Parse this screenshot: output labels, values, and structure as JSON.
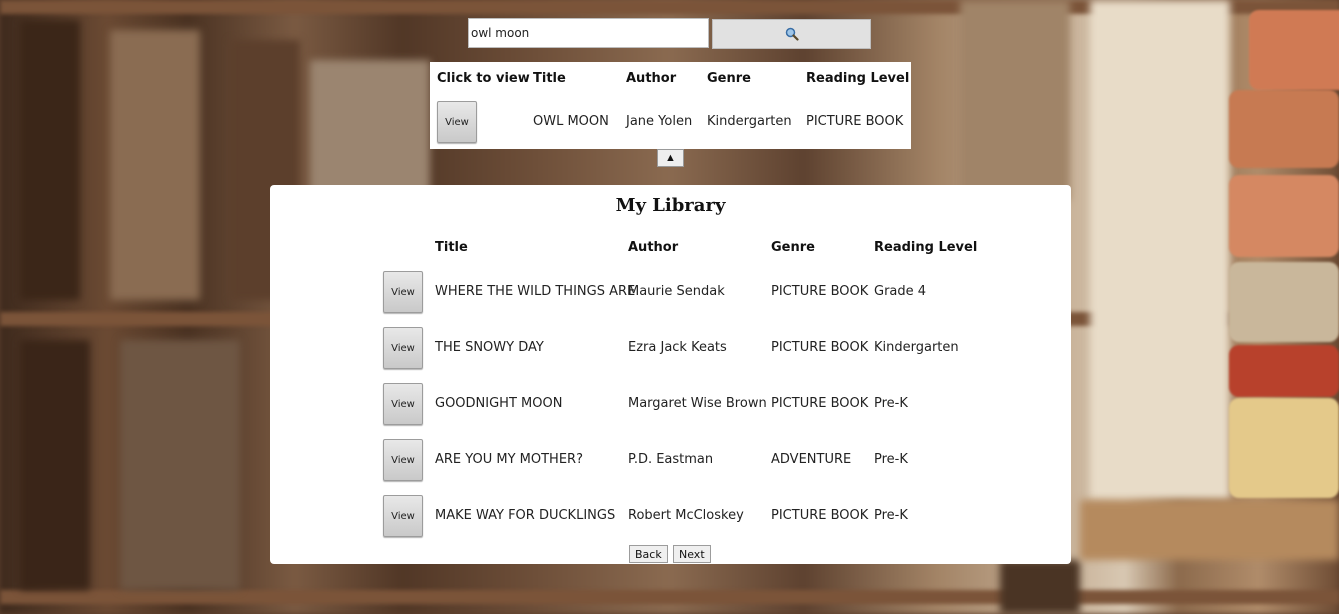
{
  "search": {
    "value": "owl moon",
    "button_icon": "magnifier-icon"
  },
  "results": {
    "headers": [
      "Click to view",
      "Title",
      "Author",
      "Genre",
      "Reading Level"
    ],
    "rows": [
      {
        "button": "View",
        "title": "OWL MOON",
        "author": "Jane Yolen",
        "genre": "Kindergarten",
        "level": "PICTURE BOOK"
      }
    ],
    "collapse_label": "▲"
  },
  "library": {
    "title": "My Library",
    "headers": [
      "Title",
      "Author",
      "Genre",
      "Reading Level"
    ],
    "rows": [
      {
        "button": "View",
        "title": "WHERE THE WILD THINGS ARE",
        "author": "Maurie Sendak",
        "genre": "PICTURE BOOK",
        "level": "Grade 4"
      },
      {
        "button": "View",
        "title": "THE SNOWY DAY",
        "author": "Ezra Jack Keats",
        "genre": "PICTURE BOOK",
        "level": "Kindergarten"
      },
      {
        "button": "View",
        "title": "GOODNIGHT MOON",
        "author": "Margaret Wise Brown",
        "genre": "PICTURE BOOK",
        "level": "Pre-K"
      },
      {
        "button": "View",
        "title": "ARE YOU MY MOTHER?",
        "author": "P.D. Eastman",
        "genre": "ADVENTURE",
        "level": "Pre-K"
      },
      {
        "button": "View",
        "title": "MAKE WAY FOR DUCKLINGS",
        "author": "Robert McCloskey",
        "genre": "PICTURE BOOK",
        "level": "Pre-K"
      }
    ],
    "back_label": "Back",
    "next_label": "Next"
  },
  "colors": {
    "panel": "#ffffff",
    "button_face": "#d6d6d6",
    "background_wood": "#6b4a33"
  }
}
